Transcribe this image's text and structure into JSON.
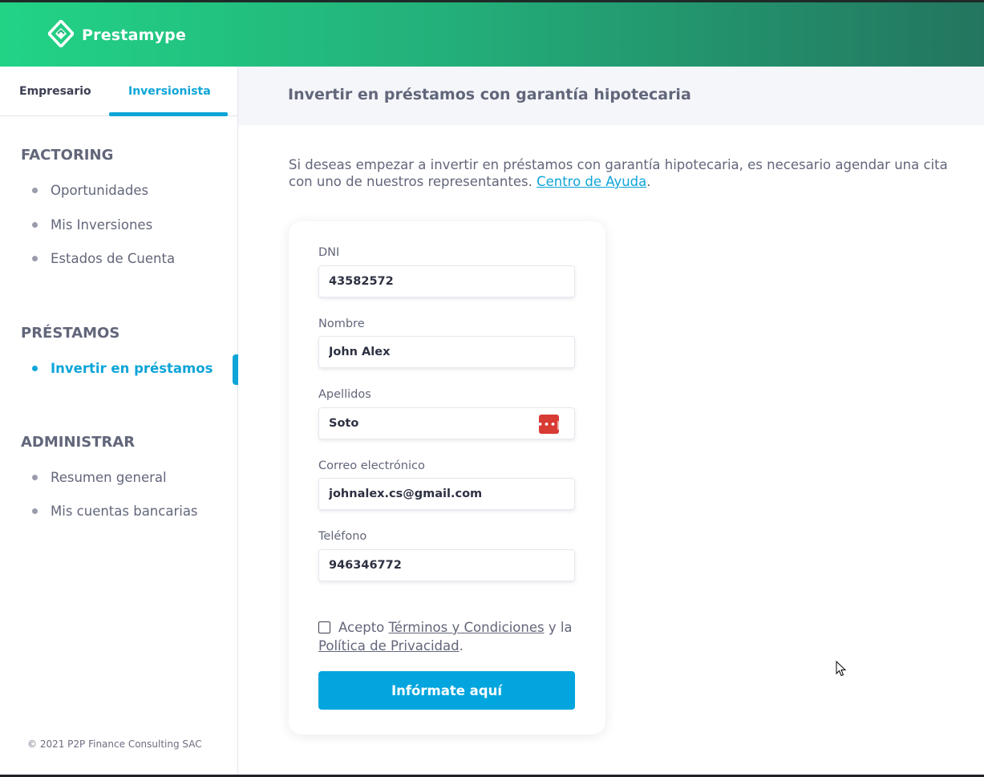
{
  "brand": {
    "name": "Prestamype",
    "logo_icon": "prestamype-diamond-logo"
  },
  "colors": {
    "accent": "#0ea5d8",
    "brand_green": "#22d386",
    "brand_dark": "#23755f",
    "danger": "#d83a34"
  },
  "tabs": [
    {
      "label": "Empresario",
      "active": false
    },
    {
      "label": "Inversionista",
      "active": true
    }
  ],
  "sidebar": {
    "factoring": {
      "title": "FACTORING",
      "items": [
        "Oportunidades",
        "Mis Inversiones",
        "Estados de Cuenta"
      ]
    },
    "prestamos": {
      "title": "PRÉSTAMOS",
      "items": [
        "Invertir en préstamos"
      ],
      "active_item": "Invertir en préstamos"
    },
    "administrar": {
      "title": "ADMINISTRAR",
      "items": [
        "Resumen general",
        "Mis cuentas bancarias"
      ]
    },
    "copyright": "© 2021 P2P Finance Consulting SAC"
  },
  "header": {
    "title": "Invertir en préstamos con garantía hipotecaria"
  },
  "intro": {
    "text": "Si deseas empezar a invertir en préstamos con garantía hipotecaria, es necesario agendar una cita con uno de nuestros representantes. ",
    "link": "Centro de Ayuda",
    "end": "."
  },
  "form": {
    "dni": {
      "label": "DNI",
      "value": "43582572"
    },
    "nombre": {
      "label": "Nombre",
      "value": "John Alex"
    },
    "apellidos": {
      "label": "Apellidos",
      "value": "Soto",
      "badge_icon": "password-manager-icon"
    },
    "correo": {
      "label": "Correo electrónico",
      "value": "johnalex.cs@gmail.com"
    },
    "telefono": {
      "label": "Teléfono",
      "value": "946346772"
    },
    "terms": {
      "prefix": "Acepto ",
      "terms_link": "Términos y Condiciones",
      "middle": " y la ",
      "privacy_link": "Política de Privacidad",
      "suffix": ".",
      "checked": false
    },
    "submit_label": "Infórmate aquí"
  }
}
